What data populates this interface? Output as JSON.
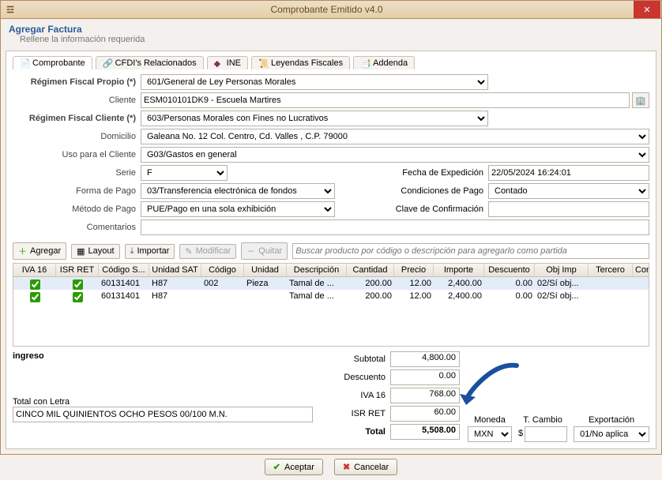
{
  "window": {
    "title": "Comprobante Emitido v4.0"
  },
  "header": {
    "title": "Agregar Factura",
    "subtitle": "Rellene la información requerida"
  },
  "tabs": {
    "t0": "Comprobante",
    "t1": "CFDI's Relacionados",
    "t2": "INE",
    "t3": "Leyendas Fiscales",
    "t4": "Addenda"
  },
  "form": {
    "regimen_propio_label": "Régimen Fiscal Propio (*)",
    "regimen_propio": "601/General de Ley Personas Morales",
    "cliente_label": "Cliente",
    "cliente": "ESM010101DK9 - Escuela Martires",
    "regimen_cliente_label": "Régimen Fiscal Cliente (*)",
    "regimen_cliente": "603/Personas Morales con Fines no Lucrativos",
    "domicilio_label": "Domicilio",
    "domicilio": "Galeana No. 12 Col. Centro, Cd. Valles , C.P. 79000",
    "uso_label": "Uso para el Cliente",
    "uso": "G03/Gastos en general",
    "serie_label": "Serie",
    "serie": "F",
    "fecha_label": "Fecha de Expedición",
    "fecha": "22/05/2024 16:24:01",
    "forma_label": "Forma de Pago",
    "forma": "03/Transferencia electrónica de fondos",
    "cond_label": "Condiciones de Pago",
    "cond": "Contado",
    "metodo_label": "Método de Pago",
    "metodo": "PUE/Pago en una sola exhibición",
    "clave_label": "Clave de Confirmación",
    "clave": "",
    "comentarios_label": "Comentarios",
    "comentarios": ""
  },
  "toolbar": {
    "agregar": "Agregar",
    "layout": "Layout",
    "importar": "Importar",
    "modificar": "Modificar",
    "quitar": "Quitar",
    "search_placeholder": "Buscar producto por código o descripción para agregarlo como partida"
  },
  "grid": {
    "headers": {
      "c0": "IVA 16",
      "c1": "ISR RET",
      "c2": "Código S...",
      "c3": "Unidad SAT",
      "c4": "Código",
      "c5": "Unidad",
      "c6": "Descripción",
      "c7": "Cantidad",
      "c8": "Precio",
      "c9": "Importe",
      "c10": "Descuento",
      "c11": "Obj Imp",
      "c12": "Tercero",
      "c13": "Comenta..."
    },
    "rows": [
      {
        "iva": true,
        "isr": true,
        "cods": "60131401",
        "usat": "H87",
        "cod": "002",
        "uni": "Pieza",
        "desc": "Tamal de ...",
        "cant": "200.00",
        "prec": "12.00",
        "imp": "2,400.00",
        "descu": "0.00",
        "obj": "02/Sí obj...",
        "ter": "",
        "com": ""
      },
      {
        "iva": true,
        "isr": true,
        "cods": "60131401",
        "usat": "H87",
        "cod": "",
        "uni": "",
        "desc": "Tamal de ...",
        "cant": "200.00",
        "prec": "12.00",
        "imp": "2,400.00",
        "descu": "0.00",
        "obj": "02/Sí obj...",
        "ter": "",
        "com": ""
      }
    ]
  },
  "totals": {
    "tipo": "ingreso",
    "subtotal_label": "Subtotal",
    "subtotal": "4,800.00",
    "descuento_label": "Descuento",
    "descuento": "0.00",
    "iva_label": "IVA 16",
    "iva": "768.00",
    "isr_label": "ISR RET",
    "isr": "60.00",
    "total_label": "Total",
    "total": "5,508.00",
    "total_letra_label": "Total con Letra",
    "total_letra": "CINCO MIL QUINIENTOS OCHO PESOS 00/100 M.N.",
    "moneda_label": "Moneda",
    "moneda": "MXN",
    "tcambio_label": "T. Cambio",
    "tcambio_prefix": "$",
    "tcambio": "",
    "export_label": "Exportación",
    "export": "01/No aplica"
  },
  "footer": {
    "aceptar": "Aceptar",
    "cancelar": "Cancelar"
  }
}
